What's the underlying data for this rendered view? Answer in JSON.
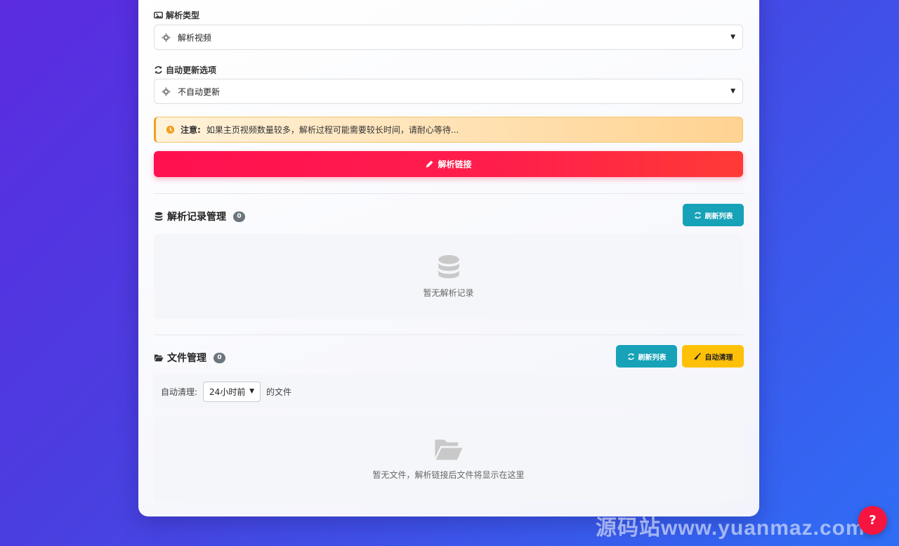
{
  "parse_type": {
    "label": "解析类型",
    "selected": "解析视频"
  },
  "auto_update": {
    "label": "自动更新选项",
    "selected": "不自动更新"
  },
  "notice": {
    "title": "注意:",
    "text": "如果主页视频数量较多，解析过程可能需要较长时间，请耐心等待..."
  },
  "parse_button": {
    "label": "解析链接"
  },
  "records": {
    "title": "解析记录管理",
    "count": "0",
    "refresh_label": "刷新列表",
    "empty_text": "暂无解析记录"
  },
  "files": {
    "title": "文件管理",
    "count": "0",
    "refresh_label": "刷新列表",
    "auto_clean_label": "自动清理",
    "clean_prefix": "自动清理:",
    "clean_option": "24小时前",
    "clean_suffix": "的文件",
    "empty_text": "暂无文件，解析链接后文件将显示在这里"
  },
  "help_button": {
    "label": "?"
  },
  "watermark": "源码站www.yuanmaz.com",
  "colors": {
    "primary": "#ff1f4b",
    "teal": "#17a2b8",
    "yellow": "#ffc107",
    "notice_bg": "#ffd391"
  }
}
